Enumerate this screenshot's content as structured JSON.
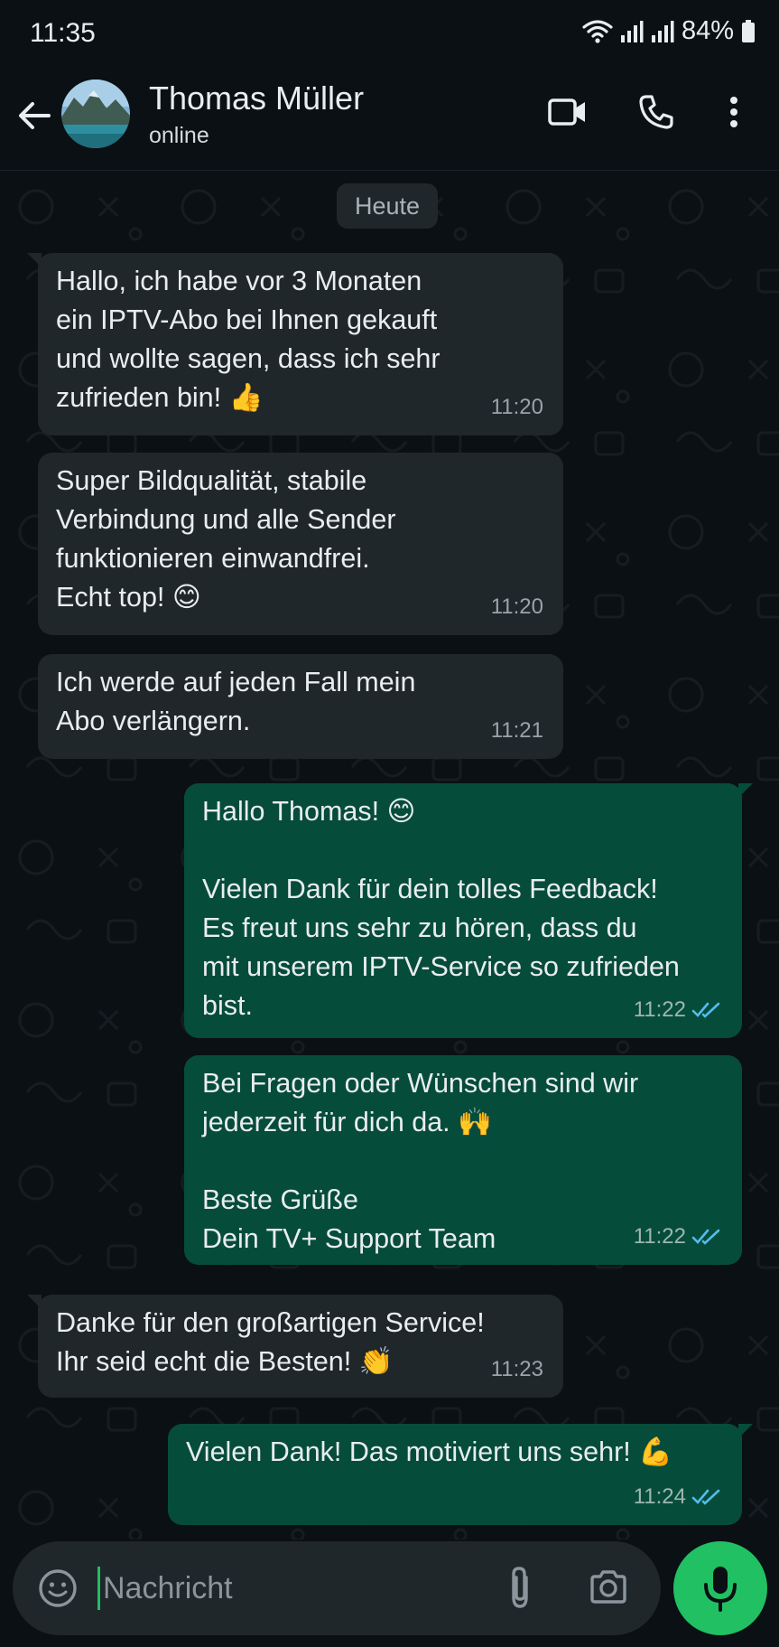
{
  "status_bar": {
    "time": "11:35",
    "battery": "84%"
  },
  "header": {
    "contact_name": "Thomas Müller",
    "contact_status": "online",
    "icons": [
      "back-arrow-icon",
      "video-call-icon",
      "phone-icon",
      "more-vert-icon"
    ]
  },
  "chat": {
    "date_label": "Heute",
    "messages": [
      {
        "direction": "in",
        "text": "Hallo, ich habe vor 3 Monaten\nein IPTV-Abo bei Ihnen gekauft\nund wollte sagen, dass ich sehr\nzufrieden bin! 👍",
        "time": "11:20"
      },
      {
        "direction": "in",
        "text": "Super Bildqualität, stabile\nVerbindung und alle Sender\nfunktionieren einwandfrei.\nEcht top! 😊",
        "time": "11:20"
      },
      {
        "direction": "in",
        "text": "Ich werde auf jeden Fall mein\nAbo verlängern.",
        "time": "11:21"
      },
      {
        "direction": "out",
        "text": "Hallo Thomas! 😊\n\nVielen Dank für dein tolles Feedback!\nEs freut uns sehr zu hören, dass du\nmit unserem IPTV-Service so zufrieden\nbist.",
        "time": "11:22",
        "read": true
      },
      {
        "direction": "out",
        "text": "Bei Fragen oder Wünschen sind wir\njederzeit für dich da. 🙌\n\nBeste Grüße\nDein TV+ Support Team",
        "time": "11:22",
        "read": true
      },
      {
        "direction": "in",
        "text": "Danke für den großartigen Service!\nIhr seid echt die Besten! 👏",
        "time": "11:23"
      },
      {
        "direction": "out",
        "text": "Vielen Dank! Das motiviert uns sehr! 💪",
        "time": "11:24",
        "read": true
      }
    ]
  },
  "input": {
    "placeholder": "Nachricht"
  },
  "colors": {
    "background": "#0b1014",
    "incoming_bubble": "#1f272a",
    "outgoing_bubble": "#064c3b",
    "accent_green": "#21c063",
    "read_ticks": "#53bdeb"
  }
}
